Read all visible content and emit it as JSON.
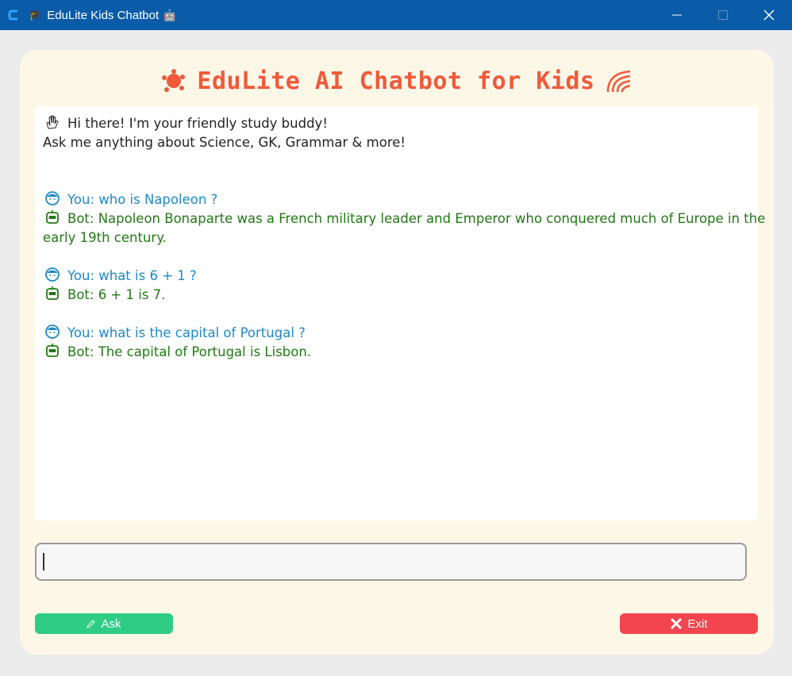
{
  "window": {
    "title": "EduLite Kids Chatbot",
    "icons": [
      "app-logo-icon",
      "graduation-cap-icon",
      "robot-icon"
    ],
    "controls": [
      "minimize",
      "maximize",
      "close"
    ]
  },
  "header": {
    "title": "EduLite AI Chatbot for Kids",
    "left_icon": "paint-splash-icon",
    "right_icon": "rainbow-icon",
    "color": "#ef5a3a"
  },
  "chat": {
    "greeting": {
      "line1": "Hi there! I'm your friendly study buddy!",
      "line2": "Ask me anything about Science, GK, Grammar & more!",
      "icon": "waving-hand-icon"
    },
    "messages": [
      {
        "role": "user",
        "text": "You: who is Napoleon ?"
      },
      {
        "role": "bot",
        "text": "Bot: Napoleon Bonaparte was a French military leader and Emperor who conquered much of Europe in the",
        "cont": "early 19th century."
      },
      {
        "role": "user",
        "text": "You: what is 6 + 1 ?"
      },
      {
        "role": "bot",
        "text": "Bot: 6 + 1 is 7."
      },
      {
        "role": "user",
        "text": "You: what is the capital of Portugal ?"
      },
      {
        "role": "bot",
        "text": "Bot: The capital of Portugal is Lisbon."
      }
    ],
    "colors": {
      "user": "#1e88c8",
      "bot": "#207a13"
    }
  },
  "input": {
    "value": "",
    "placeholder": ""
  },
  "buttons": {
    "ask_label": "Ask",
    "ask_icon": "pencil-icon",
    "exit_label": "Exit",
    "exit_icon": "x-icon",
    "ask_color": "#2ecc84",
    "exit_color": "#f2454f"
  }
}
